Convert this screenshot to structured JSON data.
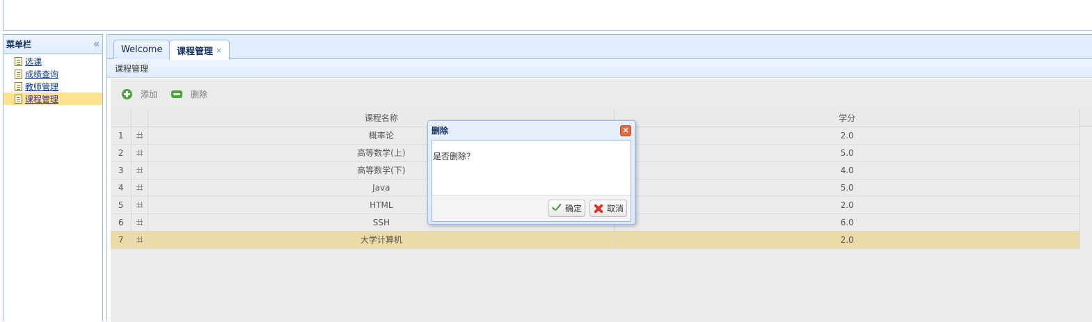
{
  "sidebar": {
    "title": "菜单栏",
    "collapse_icon": "«",
    "items": [
      {
        "label": "选课"
      },
      {
        "label": "成绩查询"
      },
      {
        "label": "教师管理"
      },
      {
        "label": "课程管理",
        "selected": true
      }
    ]
  },
  "tabs": [
    {
      "label": "Welcome"
    },
    {
      "label": "课程管理",
      "active": true,
      "close": "×"
    }
  ],
  "panel": {
    "title": "课程管理"
  },
  "toolbar": {
    "add_label": "添加",
    "delete_label": "删除"
  },
  "grid": {
    "columns": [
      "课程名称",
      "学分"
    ],
    "rows": [
      {
        "num": "1",
        "name": "概率论",
        "credit": "2.0"
      },
      {
        "num": "2",
        "name": "高等数学(上)",
        "credit": "5.0"
      },
      {
        "num": "3",
        "name": "高等数学(下)",
        "credit": "4.0"
      },
      {
        "num": "4",
        "name": "Java",
        "credit": "5.0"
      },
      {
        "num": "5",
        "name": "HTML",
        "credit": "2.0"
      },
      {
        "num": "6",
        "name": "SSH",
        "credit": "6.0"
      },
      {
        "num": "7",
        "name": "大学计算机",
        "credit": "2.0",
        "selected": true
      }
    ]
  },
  "dialog": {
    "title": "删除",
    "close": "×",
    "message": "是否删除？",
    "ok_label": "确定",
    "cancel_label": "取消"
  },
  "colors": {
    "border": "#95b8e7",
    "header_bg": "#e0ecff",
    "selected_row": "#ecdba6",
    "selected_tree": "#ffe48d"
  }
}
